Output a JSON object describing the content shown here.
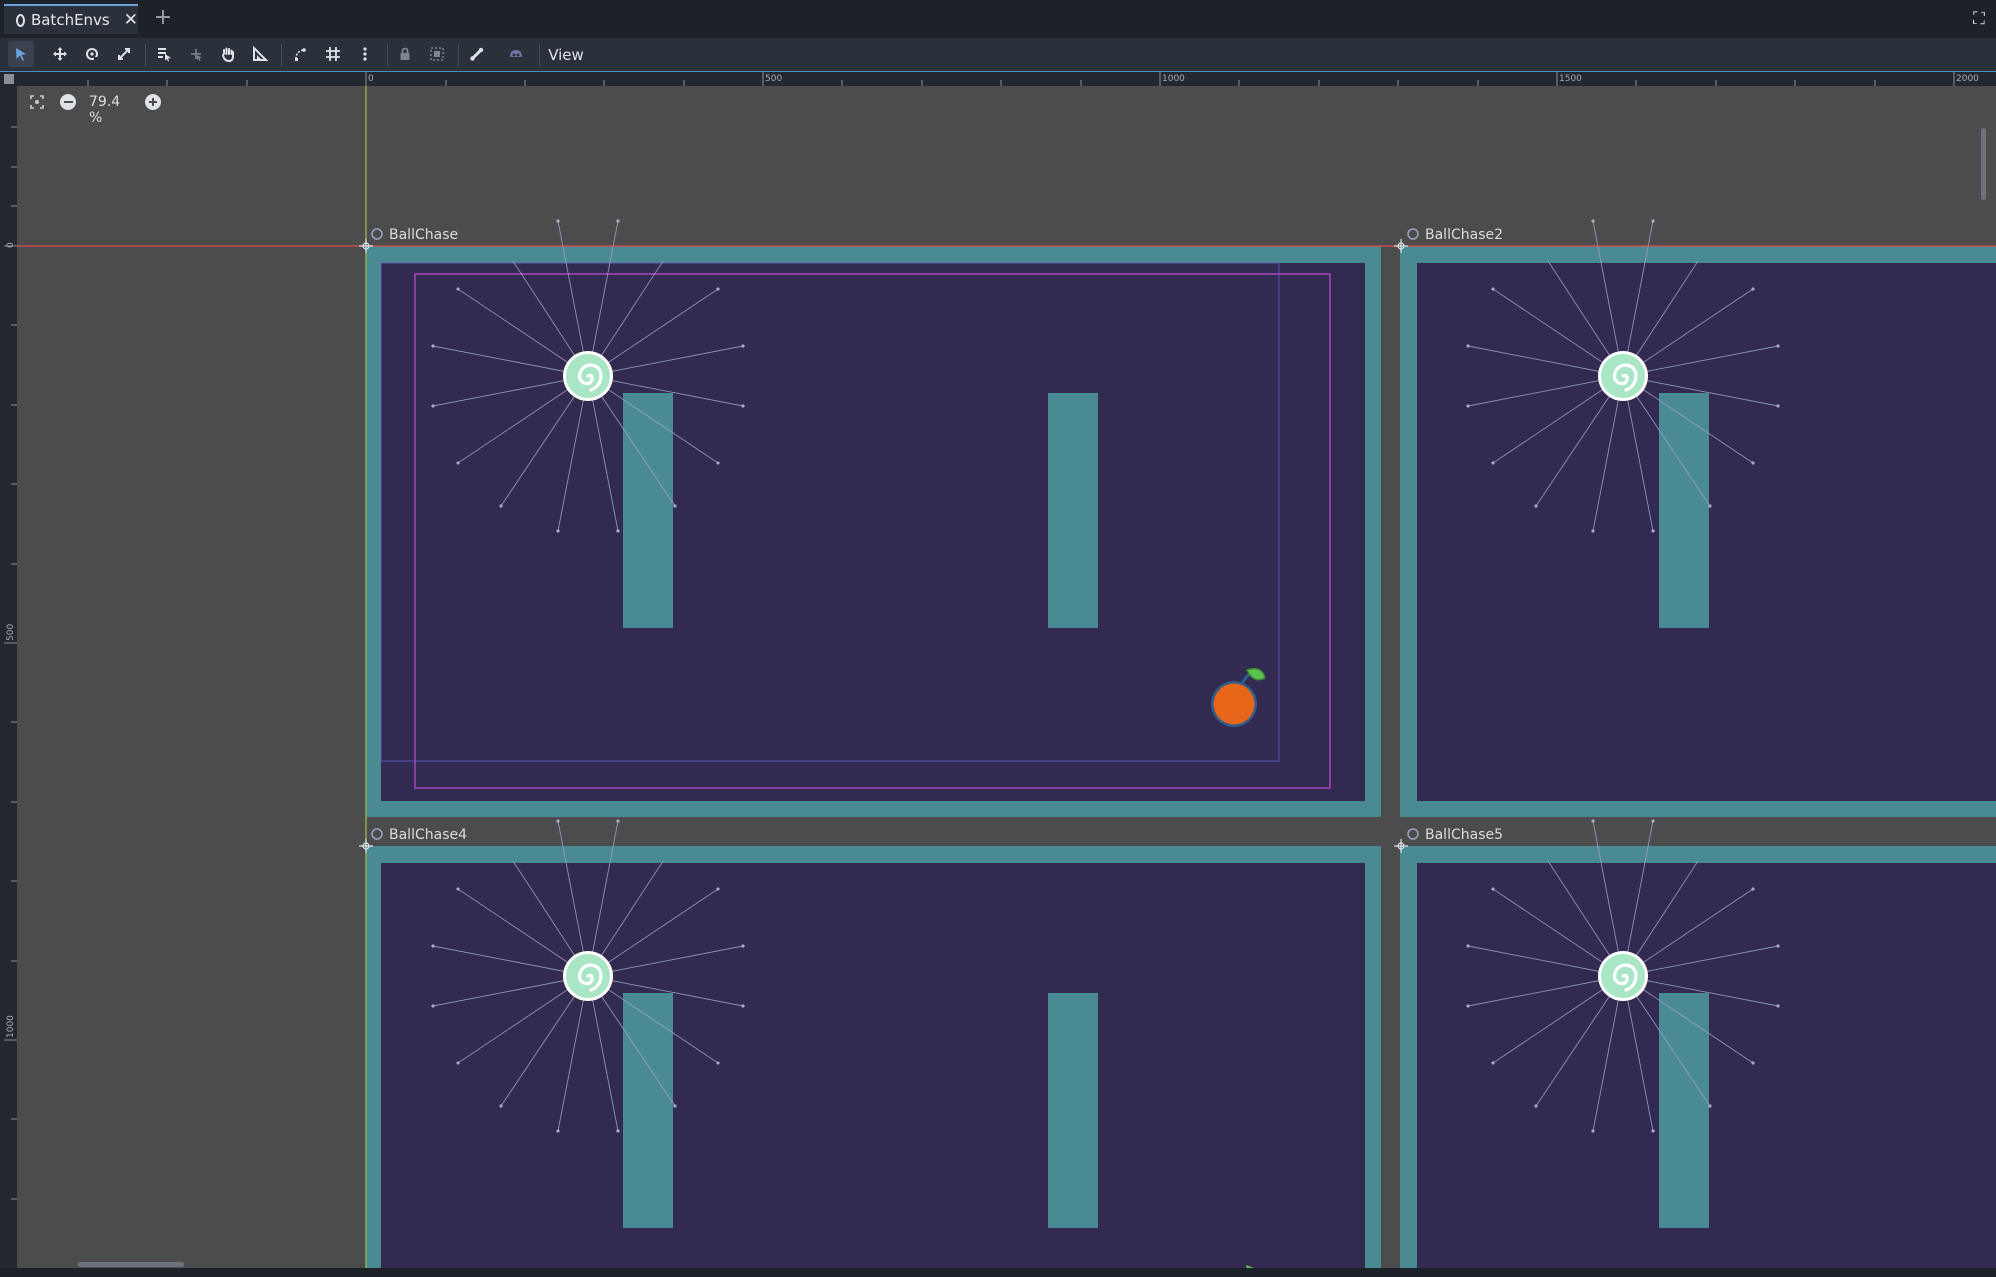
{
  "tabs": [
    {
      "label": "BatchEnvs",
      "close": "✕"
    }
  ],
  "add_tab_label": "+",
  "toolbar": {
    "tools": [
      "select-icon",
      "move-icon",
      "rotate-icon",
      "scale-icon",
      "list-select-icon",
      "pivot-icon",
      "pan-icon",
      "ruler-icon",
      "smart-snap-icon",
      "grid-snap-icon",
      "more-options-icon",
      "lock-icon",
      "group-icon",
      "skeleton-icon",
      "override-camera-icon"
    ],
    "view_label": "View"
  },
  "zoom": {
    "value": "79.4 %"
  },
  "ruler": {
    "h_labels": [
      "0",
      "500",
      "1000",
      "1500",
      "2000"
    ],
    "v_labels": [
      "0",
      "500",
      "1000"
    ]
  },
  "scene_nodes": [
    {
      "name": "BallChase"
    },
    {
      "name": "BallChase2"
    },
    {
      "name": "BallChase4"
    },
    {
      "name": "BallChase5"
    }
  ],
  "colors": {
    "viewport_bg": "#4c4c4c",
    "room_floor": "#322a50",
    "wall": "#4a8a92",
    "agent": "#a8e6c6",
    "fruit": "#e8661a",
    "leaf": "#5cc24f",
    "accent": "#6ba2dd"
  }
}
